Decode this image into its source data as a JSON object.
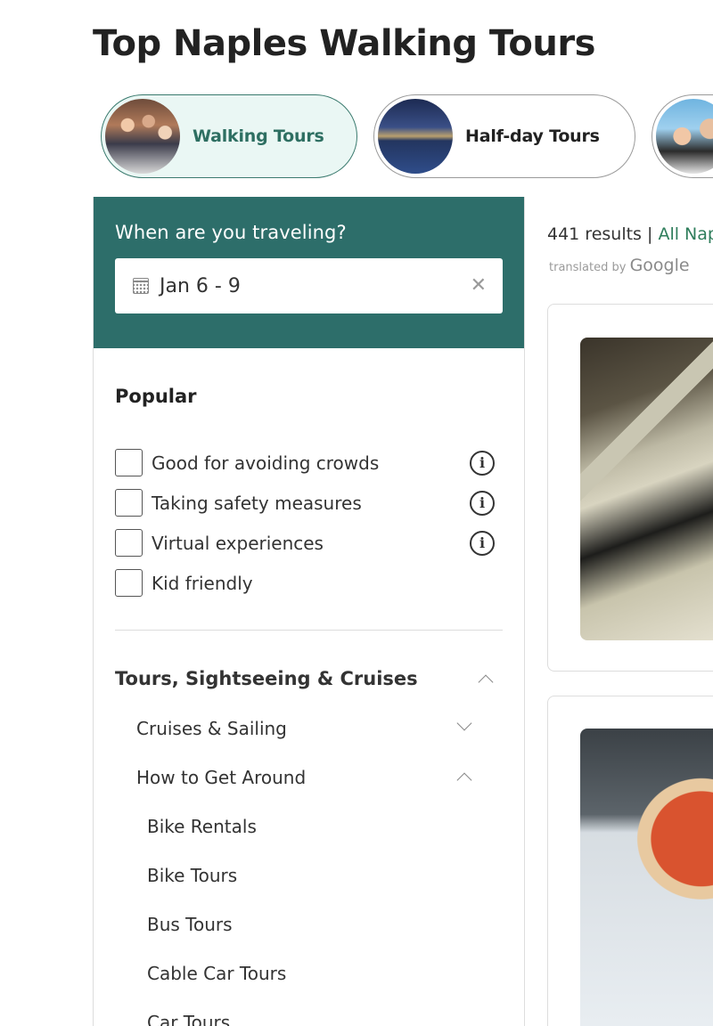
{
  "page": {
    "title": "Top Naples Walking Tours"
  },
  "categories": [
    {
      "label": "Walking Tours",
      "thumb": "walking-tours-photo",
      "active": true
    },
    {
      "label": "Half-day Tours",
      "thumb": "half-day-tours-photo",
      "active": false
    },
    {
      "label": "",
      "thumb": "group-tour-photo",
      "active": false
    }
  ],
  "filters": {
    "date": {
      "heading": "When are you traveling?",
      "value": "Jan 6 - 9",
      "icon": "calendar-icon",
      "clear_icon": "close-icon"
    },
    "popular": {
      "title": "Popular",
      "options": [
        {
          "label": "Good for avoiding crowds",
          "checked": false,
          "has_info": true
        },
        {
          "label": "Taking safety measures",
          "checked": false,
          "has_info": true
        },
        {
          "label": "Virtual experiences",
          "checked": false,
          "has_info": true
        },
        {
          "label": "Kid friendly",
          "checked": false,
          "has_info": false
        }
      ]
    },
    "tours": {
      "title": "Tours, Sightseeing & Cruises",
      "expanded": true,
      "groups": [
        {
          "label": "Cruises & Sailing",
          "expanded": false
        },
        {
          "label": "How to Get Around",
          "expanded": true
        }
      ],
      "items": [
        "Bike Rentals",
        "Bike Tours",
        "Bus Tours",
        "Cable Car Tours",
        "Car Tours"
      ]
    }
  },
  "results": {
    "count": "441 results",
    "separator": " | ",
    "link": "All Nap",
    "translated_prefix": "translated by ",
    "translated_brand": "Google"
  },
  "colors": {
    "teal": "#2d6e6a",
    "accent_green": "#2e7d5b",
    "active_pill_bg": "#eaf7f4"
  }
}
